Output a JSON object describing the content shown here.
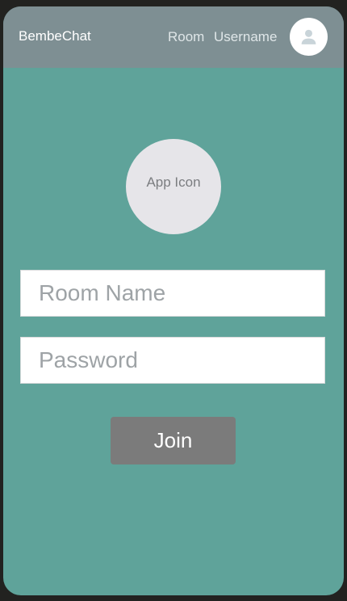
{
  "header": {
    "brand": "BembeChat",
    "nav_room": "Room",
    "nav_username": "Username",
    "avatar_icon": "person-icon"
  },
  "main": {
    "app_icon_label": "App Icon",
    "room_name_placeholder": "Room Name",
    "room_name_value": "",
    "password_placeholder": "Password",
    "password_value": "",
    "join_label": "Join"
  },
  "colors": {
    "header_bg": "#7e8f93",
    "page_bg": "#5fa39a",
    "button_bg": "#7b7b7b",
    "app_icon_bg": "#e6e5e9"
  }
}
